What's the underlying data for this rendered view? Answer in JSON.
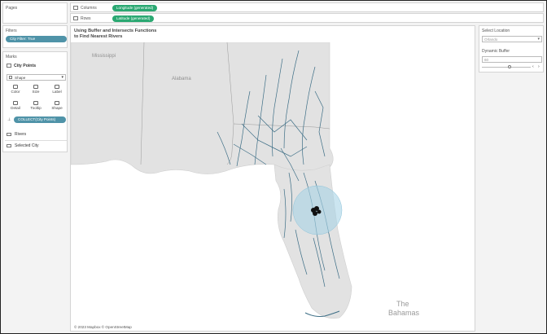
{
  "left_panel": {
    "pages_title": "Pages",
    "filters_title": "Filters",
    "filter_pill": "City Filter: True",
    "marks_title": "Marks",
    "city_points_label": "City Points",
    "mark_type": "Shape",
    "mark_buttons": [
      "Color",
      "Size",
      "Label",
      "Detail",
      "Tooltip",
      "Shape"
    ],
    "collect_pill": "COLLECT(City Points)",
    "layers": [
      "Rivers",
      "Selected City"
    ]
  },
  "shelves": {
    "columns_label": "Columns",
    "columns_pill": "Longitude (generated)",
    "rows_label": "Rows",
    "rows_pill": "Latitude (generated)"
  },
  "view": {
    "title_line1": "Using Buffer and Intersects Functions",
    "title_line2": "to Find Nearest Rivers",
    "map_labels": {
      "mississippi": "Mississippi",
      "alabama": "Alabama",
      "bahamas_1": "The",
      "bahamas_2": "Bahamas"
    },
    "attribution": "© 2023 Mapbox © OpenStreetMap"
  },
  "right_panel": {
    "select_location_title": "Select Location",
    "select_location_value": "Orlando",
    "dynamic_buffer_title": "Dynamic Buffer",
    "dynamic_buffer_value": "60"
  },
  "colors": {
    "river": "#3d6e86",
    "land": "#e2e2e2",
    "buffer": "#a8d4e6",
    "green_pill": "#2aa872",
    "teal_pill": "#4f93a8"
  }
}
